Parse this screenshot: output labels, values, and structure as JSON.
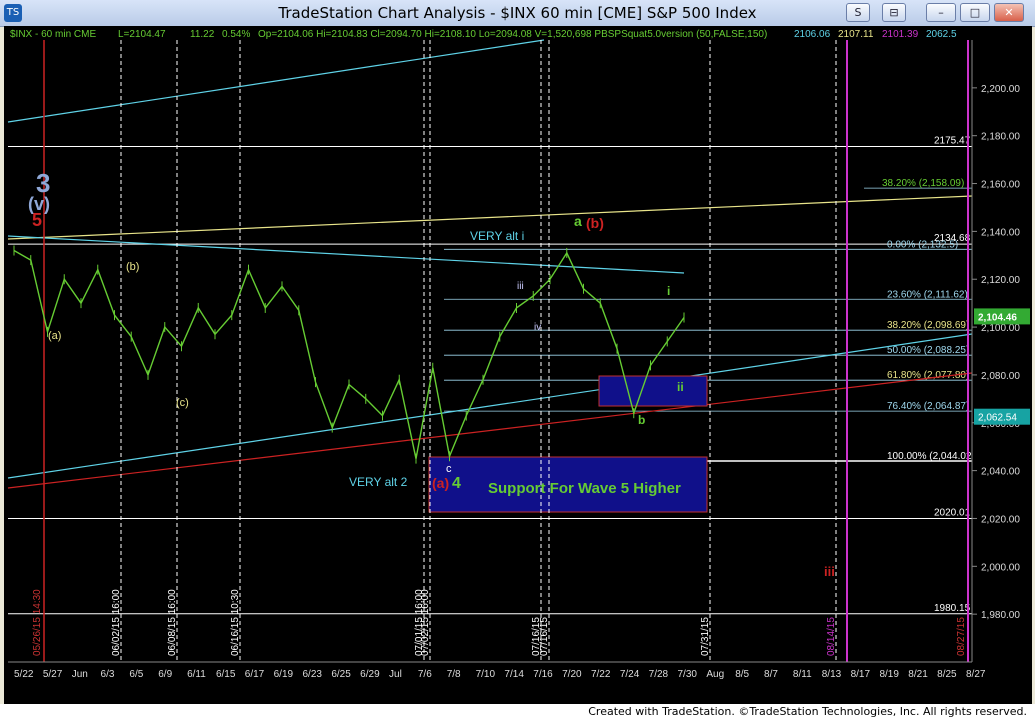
{
  "window": {
    "title": "TradeStation Chart Analysis - $INX 60 min [CME] S&P 500 Index",
    "buttons": [
      "S",
      "⊟",
      "–",
      "□",
      "✕"
    ]
  },
  "footer": "Created with TradeStation. ©TradeStation Technologies, Inc. All rights reserved.",
  "header_line": {
    "symbol": "$INX - 60 min  CME",
    "last": "L=2104.47",
    "change": "11.22",
    "pct": "0.54%",
    "bar": "Op=2104.06  Hi=2104.83  Cl=2094.70  Hi=2108.10  Lo=2094.08  V=1,520,698  PBSPSquat5.0version (50,FALSE,150)",
    "v1": "2106.06",
    "v2": "2107.11",
    "v3": "2101.39",
    "v4": "2062.5"
  },
  "colors": {
    "background": "#000000",
    "price": "#66cc33",
    "cyan_line": "#5fd3e8",
    "red_line": "#cc2222",
    "yellow_line": "#e8e48a",
    "label_white": "#ffffff",
    "fib_label": "#9fd8ee",
    "box_fill": "#10108a",
    "magenta": "#cc33cc",
    "last_price_box": "#33aa33"
  },
  "chart_data": {
    "type": "line",
    "title": "",
    "ylim": [
      1960,
      2220
    ],
    "x_tick_labels": [
      "5/22",
      "5/27",
      "Jun",
      "6/3",
      "6/5",
      "6/9",
      "6/11",
      "6/15",
      "6/17",
      "6/19",
      "6/23",
      "6/25",
      "6/29",
      "Jul",
      "7/6",
      "7/8",
      "7/10",
      "7/14",
      "7/16",
      "7/20",
      "7/22",
      "7/24",
      "7/28",
      "7/30",
      "Aug",
      "8/5",
      "8/7",
      "8/11",
      "8/13",
      "8/17",
      "8/19",
      "8/21",
      "8/25",
      "8/27"
    ],
    "y_tick_labels": [
      "2,200.00",
      "2,180.00",
      "2,160.00",
      "2,140.00",
      "2,120.00",
      "2,100.00",
      "2,080.00",
      "2,060.00",
      "2,040.00",
      "2,020.00",
      "2,000.00",
      "1,980.00"
    ],
    "y_ticks": [
      2200,
      2180,
      2160,
      2140,
      2120,
      2100,
      2080,
      2060,
      2040,
      2020,
      2000,
      1980
    ],
    "price_path": [
      [
        0,
        2132
      ],
      [
        1,
        2128
      ],
      [
        2,
        2098
      ],
      [
        3,
        2120
      ],
      [
        4,
        2110
      ],
      [
        5,
        2124
      ],
      [
        6,
        2105
      ],
      [
        7,
        2096
      ],
      [
        8,
        2080
      ],
      [
        9,
        2100
      ],
      [
        10,
        2092
      ],
      [
        11,
        2108
      ],
      [
        12,
        2097
      ],
      [
        13,
        2105
      ],
      [
        14,
        2124
      ],
      [
        15,
        2108
      ],
      [
        16,
        2117
      ],
      [
        17,
        2107
      ],
      [
        18,
        2077
      ],
      [
        19,
        2058
      ],
      [
        20,
        2076
      ],
      [
        21,
        2070
      ],
      [
        22,
        2063
      ],
      [
        23,
        2078
      ],
      [
        24,
        2045
      ],
      [
        25,
        2083
      ],
      [
        26,
        2046
      ],
      [
        27,
        2063
      ],
      [
        28,
        2078
      ],
      [
        29,
        2096
      ],
      [
        30,
        2108
      ],
      [
        31,
        2113
      ],
      [
        32,
        2120
      ],
      [
        33,
        2131
      ],
      [
        34,
        2116
      ],
      [
        35,
        2110
      ],
      [
        36,
        2091
      ],
      [
        37,
        2064
      ],
      [
        38,
        2084
      ],
      [
        39,
        2094
      ],
      [
        40,
        2104
      ]
    ],
    "horizontal_levels": [
      {
        "value": 2175.47,
        "label": "2175.47"
      },
      {
        "value": 2134.68,
        "label": "2134.68"
      },
      {
        "value": 2020.01,
        "label": "2020.01"
      },
      {
        "value": 1980.15,
        "label": "1980.15"
      }
    ],
    "fib_levels": [
      {
        "value": 2158.09,
        "label": "38.20% (2,158.09)",
        "color": "#66cc33"
      },
      {
        "value": 2132.5,
        "label": "0.00% (2,132.5)",
        "color": "#9fd8ee"
      },
      {
        "value": 2111.62,
        "label": "23.60% (2,111.62)",
        "color": "#9fd8ee"
      },
      {
        "value": 2098.69,
        "label": "38.20% (2,098.69)",
        "color": "#e8e48a"
      },
      {
        "value": 2088.25,
        "label": "50.00% (2,088.25)",
        "color": "#9fd8ee"
      },
      {
        "value": 2077.8,
        "label": "61.80% (2,077.80)",
        "color": "#e8e48a"
      },
      {
        "value": 2064.87,
        "label": "76.40% (2,064.87)",
        "color": "#9fd8ee"
      },
      {
        "value": 2044.02,
        "label": "100.00% (2,044.02)",
        "color": "#ffffff"
      }
    ],
    "last_price": {
      "value": 2104.46,
      "label": "2,104.46"
    },
    "secondary_price": {
      "value": 2062.54,
      "label": "2,062.54"
    },
    "vertical_date_labels": [
      "05/26/15 14:30",
      "06/02/15 16:00",
      "06/08/15 16:00",
      "06/16/15 10:30",
      "07/01/15 16:00",
      "07/02/15 16:00",
      "07/16/15",
      "07/16/15",
      "07/31/15",
      "08/14/15",
      "08/27/15"
    ],
    "annotations": [
      "3",
      "(v)",
      "5",
      "VERY alt i",
      "VERY alt 2",
      "(a)",
      "4",
      "(b)",
      "a",
      "ii",
      "iii",
      "iv",
      "i",
      "b",
      "c",
      "Support For Wave 5 Higher",
      "(c)",
      "(b)",
      "(a)",
      "2020.01",
      "iii"
    ]
  }
}
